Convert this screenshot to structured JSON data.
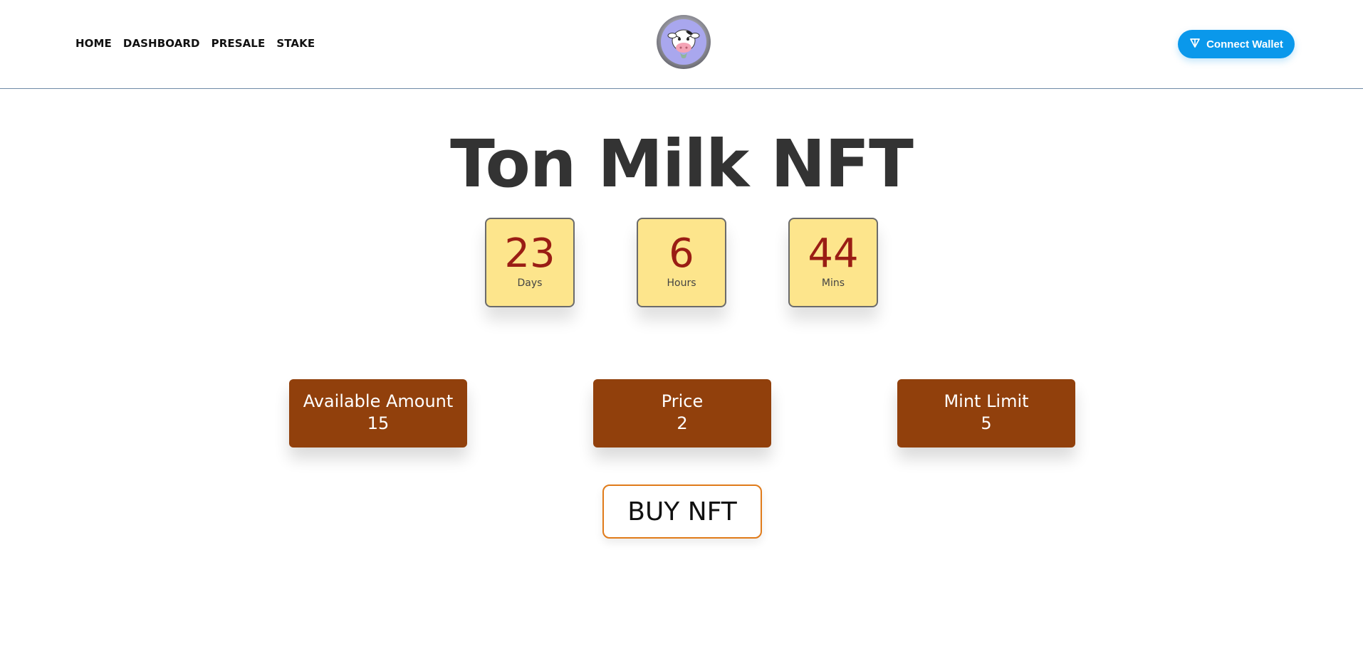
{
  "nav": {
    "items": [
      {
        "label": "HOME"
      },
      {
        "label": "DASHBOARD"
      },
      {
        "label": "PRESALE"
      },
      {
        "label": "STAKE"
      }
    ]
  },
  "header": {
    "logo_icon": "cow-avatar-logo-icon",
    "wallet_button": {
      "label": "Connect Wallet",
      "icon": "ton-diamond-icon",
      "color": "#0a98eb"
    }
  },
  "main": {
    "title": "Ton Milk NFT",
    "countdown": [
      {
        "value": "23",
        "label": "Days"
      },
      {
        "value": "6",
        "label": "Hours"
      },
      {
        "value": "44",
        "label": "Mins"
      }
    ],
    "info_cards": [
      {
        "label": "Available Amount",
        "value": "15"
      },
      {
        "label": "Price",
        "value": "2"
      },
      {
        "label": "Mint Limit",
        "value": "5"
      }
    ],
    "buy_button": {
      "label": "BUY NFT"
    }
  },
  "colors": {
    "title": "#333333",
    "countdown_bg": "#fde58c",
    "countdown_value": "#9a1d14",
    "card_bg": "#91400c",
    "buy_border": "#e07b1a",
    "header_border": "#6f8aa6"
  }
}
